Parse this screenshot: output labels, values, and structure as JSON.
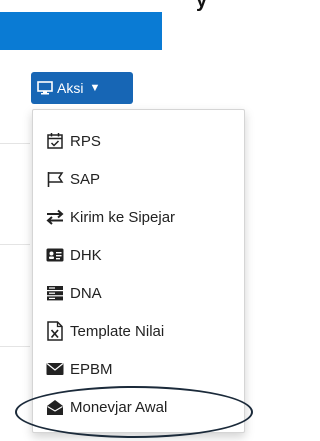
{
  "header": {
    "partial_text": "y"
  },
  "aksi_button": {
    "label": "Aksi",
    "icon": "monitor-icon",
    "caret": "caret-down-icon"
  },
  "menu": {
    "items": [
      {
        "label": "RPS",
        "icon": "calendar-check-icon"
      },
      {
        "label": "SAP",
        "icon": "flag-icon"
      },
      {
        "label": "Kirim ke Sipejar",
        "icon": "exchange-icon"
      },
      {
        "label": "DHK",
        "icon": "id-card-icon"
      },
      {
        "label": "DNA",
        "icon": "server-icon"
      },
      {
        "label": "Template Nilai",
        "icon": "excel-file-icon"
      },
      {
        "label": "EPBM",
        "icon": "envelope-icon"
      },
      {
        "label": "Monevjar Awal",
        "icon": "envelope-open-icon",
        "highlighted": true
      }
    ]
  },
  "colors": {
    "brand_blue": "#0a7bd4",
    "button_blue": "#1766b5",
    "annotation": "#1b2a3a"
  }
}
